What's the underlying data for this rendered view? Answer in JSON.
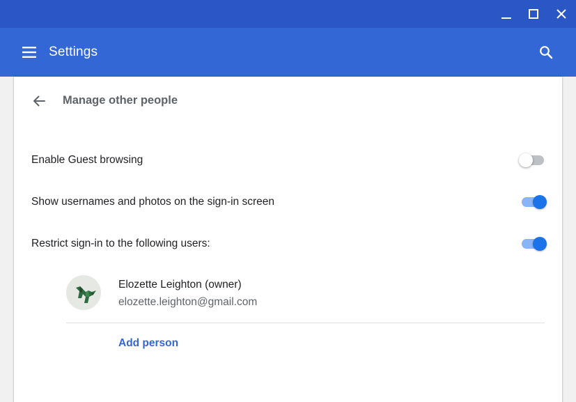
{
  "window": {
    "controls": {
      "minimize_icon": "minimize-icon",
      "maximize_icon": "maximize-icon",
      "close_icon": "close-icon"
    },
    "titlebar_color": "#2a56c6"
  },
  "toolbar": {
    "title": "Settings",
    "menu_icon": "hamburger-menu-icon",
    "search_icon": "search-icon",
    "color": "#3367d6"
  },
  "subpage": {
    "title": "Manage other people",
    "back_icon": "back-arrow-icon"
  },
  "settings": [
    {
      "label": "Enable Guest browsing",
      "enabled": false
    },
    {
      "label": "Show usernames and photos on the sign-in screen",
      "enabled": true
    },
    {
      "label": "Restrict sign-in to the following users:",
      "enabled": true
    }
  ],
  "users": [
    {
      "name": "Elozette Leighton (owner)",
      "email": "elozette.leighton@gmail.com",
      "avatar_icon": "dinosaur-avatar-icon"
    }
  ],
  "add_person_label": "Add person",
  "accent_color": "#1a73e8"
}
